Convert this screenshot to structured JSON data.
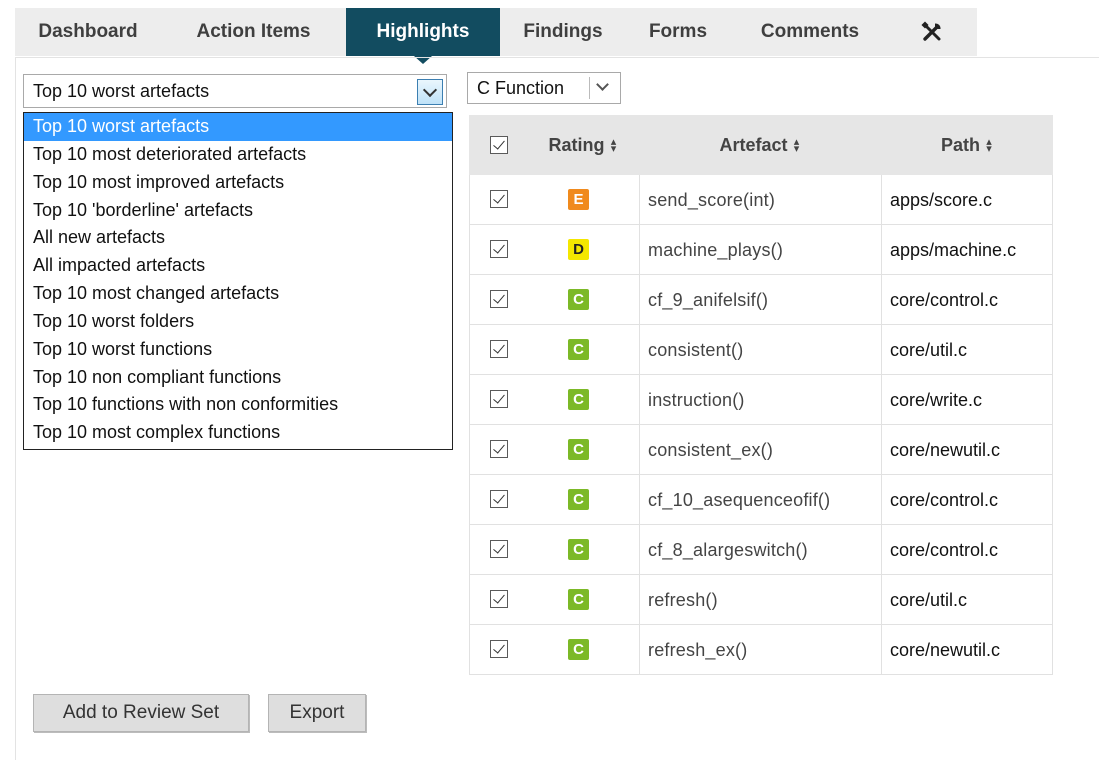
{
  "tabs": [
    {
      "label": "Dashboard",
      "active": false
    },
    {
      "label": "Action Items",
      "active": false
    },
    {
      "label": "Highlights",
      "active": true
    },
    {
      "label": "Findings",
      "active": false
    },
    {
      "label": "Forms",
      "active": false
    },
    {
      "label": "Comments",
      "active": false
    }
  ],
  "tools_icon": "tools-icon",
  "highlight_select": {
    "value": "Top 10 worst artefacts",
    "options": [
      "Top 10 worst artefacts",
      "Top 10 most deteriorated artefacts",
      "Top 10 most improved artefacts",
      "Top 10 'borderline' artefacts",
      "All new artefacts",
      "All impacted artefacts",
      "Top 10 most changed artefacts",
      "Top 10 worst folders",
      "Top 10 worst functions",
      "Top 10 non compliant functions",
      "Top 10 functions with non conformities",
      "Top 10 most complex functions"
    ],
    "highlighted_option": "Top 10 worst artefacts"
  },
  "filter_select": {
    "value": "C Function"
  },
  "table": {
    "columns": [
      "Rating",
      "Artefact",
      "Path"
    ],
    "rows": [
      {
        "checked": true,
        "rating": "E",
        "artefact": "send_score(int)",
        "path": "apps/score.c"
      },
      {
        "checked": true,
        "rating": "D",
        "artefact": "machine_plays()",
        "path": "apps/machine.c"
      },
      {
        "checked": true,
        "rating": "C",
        "artefact": "cf_9_anifelsif()",
        "path": "core/control.c"
      },
      {
        "checked": true,
        "rating": "C",
        "artefact": "consistent()",
        "path": "core/util.c"
      },
      {
        "checked": true,
        "rating": "C",
        "artefact": "instruction()",
        "path": "core/write.c"
      },
      {
        "checked": true,
        "rating": "C",
        "artefact": "consistent_ex()",
        "path": "core/newutil.c"
      },
      {
        "checked": true,
        "rating": "C",
        "artefact": "cf_10_asequenceofif()",
        "path": "core/control.c"
      },
      {
        "checked": true,
        "rating": "C",
        "artefact": "cf_8_alargeswitch()",
        "path": "core/control.c"
      },
      {
        "checked": true,
        "rating": "C",
        "artefact": "refresh()",
        "path": "core/util.c"
      },
      {
        "checked": true,
        "rating": "C",
        "artefact": "refresh_ex()",
        "path": "core/newutil.c"
      }
    ]
  },
  "rating_colors": {
    "E": {
      "bg": "#f08a1d",
      "fg": "#ffffff"
    },
    "D": {
      "bg": "#f4e700",
      "fg": "#222222"
    },
    "C": {
      "bg": "#7cb927",
      "fg": "#ffffff"
    }
  },
  "buttons": {
    "add_to_review": "Add to Review Set",
    "export": "Export"
  }
}
